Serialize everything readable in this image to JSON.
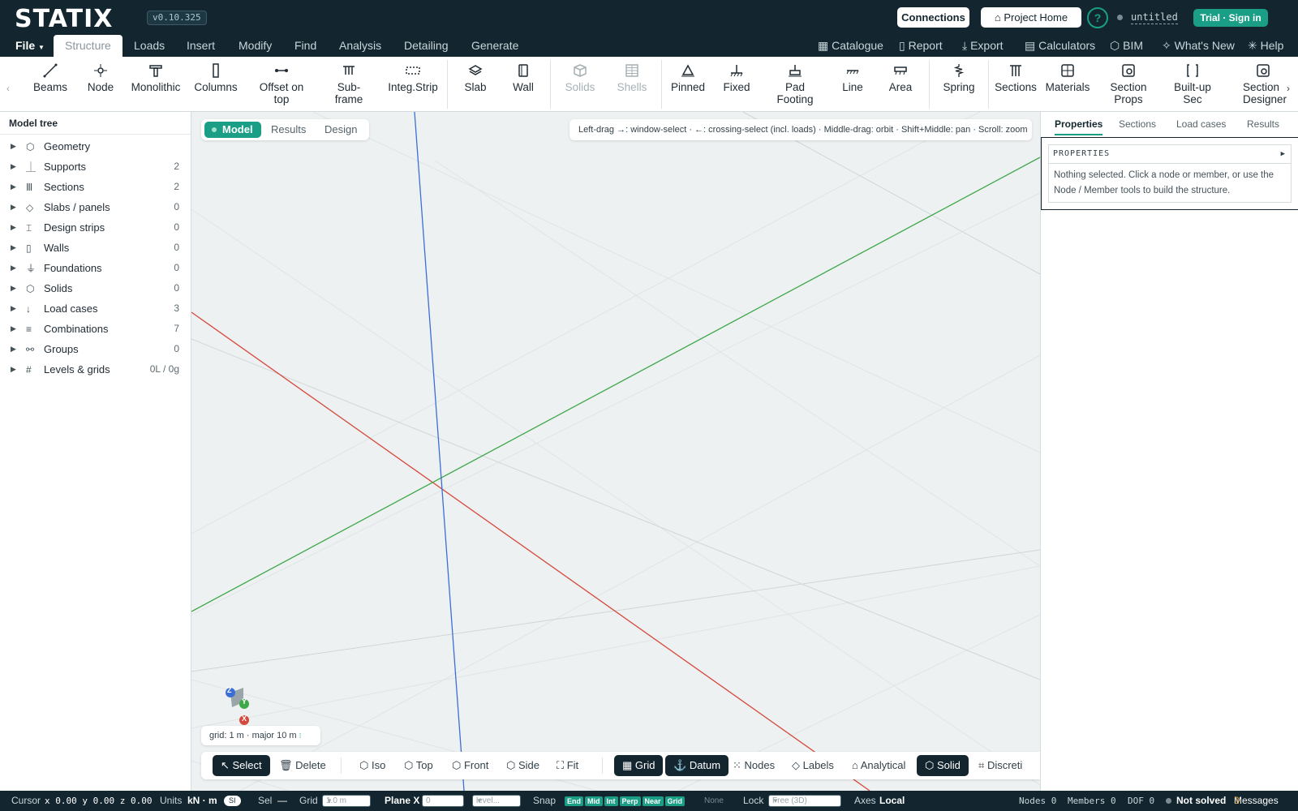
{
  "app": {
    "name": "STATIX",
    "version": "v0.10.325",
    "connections": "Connections",
    "project_home": "Project Home",
    "help_glyph": "?",
    "file_name": "untitled",
    "trial": "Trial · Sign in"
  },
  "menu": {
    "file": "File",
    "tabs": [
      "Structure",
      "Loads",
      "Insert",
      "Modify",
      "Find",
      "Analysis",
      "Detailing",
      "Generate"
    ],
    "right": [
      "Catalogue",
      "Report",
      "Export",
      "Calculators",
      "BIM",
      "What's New",
      "Help"
    ]
  },
  "ribbon": {
    "items": [
      "Beams",
      "Node",
      "Monolithic",
      "Columns",
      "Offset on top",
      "Sub-frame",
      "Integ.Strip",
      "Slab",
      "Wall",
      "Solids",
      "Shells",
      "Pinned",
      "Fixed",
      "Pad Footing",
      "Line",
      "Area",
      "Spring",
      "Sections",
      "Materials",
      "Section Props",
      "Built-up Sec",
      "Section Designer"
    ]
  },
  "tree": {
    "title": "Model tree",
    "items": [
      {
        "label": "Geometry",
        "count": "",
        "icon": "cube-icon"
      },
      {
        "label": "Supports",
        "count": "2",
        "icon": "support-icon"
      },
      {
        "label": "Sections",
        "count": "2",
        "icon": "sections-icon"
      },
      {
        "label": "Slabs / panels",
        "count": "0",
        "icon": "slab-icon"
      },
      {
        "label": "Design strips",
        "count": "0",
        "icon": "strip-icon"
      },
      {
        "label": "Walls",
        "count": "0",
        "icon": "wall-icon"
      },
      {
        "label": "Foundations",
        "count": "0",
        "icon": "foundation-icon"
      },
      {
        "label": "Solids",
        "count": "0",
        "icon": "cube-icon"
      },
      {
        "label": "Load cases",
        "count": "3",
        "icon": "load-arrow-icon"
      },
      {
        "label": "Combinations",
        "count": "7",
        "icon": "list-icon"
      },
      {
        "label": "Groups",
        "count": "0",
        "icon": "group-icon"
      },
      {
        "label": "Levels & grids",
        "count": "0L / 0g",
        "icon": "grid-hash-icon"
      }
    ]
  },
  "viewport": {
    "modes": [
      "Model",
      "Results",
      "Design"
    ],
    "hint": "Left-drag →: window-select · ←: crossing-select (incl. loads) · Middle-drag: orbit · Shift+Middle: pan · Scroll: zoom",
    "grid_info": "grid: 1 m · major 10 m",
    "axes": {
      "z": "Z",
      "y": "Y",
      "x": "X"
    },
    "toolbar": [
      "Select",
      "Delete",
      "Iso",
      "Top",
      "Front",
      "Side",
      "Fit",
      "Grid",
      "Datum",
      "Nodes",
      "Labels",
      "Analytical",
      "Solid",
      "Discreti"
    ]
  },
  "panel": {
    "tabs": [
      "Properties",
      "Sections",
      "Load cases",
      "Results"
    ],
    "header": "PROPERTIES",
    "message": "Nothing selected. Click a node or member, or use the Node / Member tools to build the structure."
  },
  "status": {
    "cursor_label": "Cursor",
    "cursor": "x 0.00 y 0.00 z 0.00",
    "units_label": "Units",
    "units": "kN · m",
    "units_badge": "SI",
    "sel_label": "Sel",
    "sel": "—",
    "grid_label": "Grid",
    "grid": "1.0 m",
    "plane_label": "Plane X",
    "plane_value": "0",
    "level": "level...",
    "snap_label": "Snap",
    "snaps": [
      "End",
      "Mid",
      "Int",
      "Perp",
      "Near",
      "Grid"
    ],
    "snap_none": "None",
    "lock_label": "Lock",
    "lock": "Free (3D)",
    "axes_label": "Axes",
    "axes": "Local",
    "nodes": "Nodes 0",
    "members": "Members 0",
    "dof": "DOF 0",
    "solved": "Not solved",
    "messages_label": "Messages",
    "messages_count": "3"
  },
  "colors": {
    "bg_dark": "#13262f",
    "accent": "#1a9e85",
    "axis_x": "#d6493d",
    "axis_y": "#3fa84a",
    "axis_z": "#3b6fd6"
  }
}
